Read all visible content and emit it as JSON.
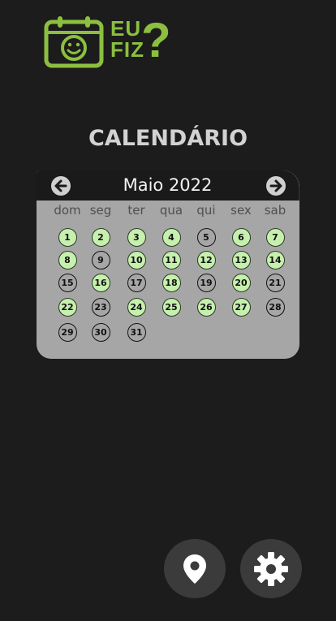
{
  "logo": {
    "line1": "EU",
    "line2": "FIZ",
    "mark": "?",
    "icon": "smiley-calendar-icon",
    "color": "#8cbf3f"
  },
  "page_title": "CALENDÁRIO",
  "calendar": {
    "month_label": "Maio 2022",
    "prev_icon": "arrow-left-icon",
    "next_icon": "arrow-right-icon",
    "weekdays": [
      "dom",
      "seg",
      "ter",
      "qua",
      "qui",
      "sex",
      "sab"
    ],
    "days": [
      {
        "label": "1",
        "status": "done"
      },
      {
        "label": "2",
        "status": "done"
      },
      {
        "label": "3",
        "status": "done"
      },
      {
        "label": "4",
        "status": "done"
      },
      {
        "label": "5",
        "status": "not-done"
      },
      {
        "label": "6",
        "status": "done"
      },
      {
        "label": "7",
        "status": "done"
      },
      {
        "label": "8",
        "status": "done"
      },
      {
        "label": "9",
        "status": "not-done"
      },
      {
        "label": "10",
        "status": "done"
      },
      {
        "label": "11",
        "status": "done"
      },
      {
        "label": "12",
        "status": "done"
      },
      {
        "label": "13",
        "status": "done"
      },
      {
        "label": "14",
        "status": "done"
      },
      {
        "label": "15",
        "status": "not-done"
      },
      {
        "label": "16",
        "status": "done"
      },
      {
        "label": "17",
        "status": "not-done"
      },
      {
        "label": "18",
        "status": "done"
      },
      {
        "label": "19",
        "status": "not-done"
      },
      {
        "label": "20",
        "status": "done"
      },
      {
        "label": "21",
        "status": "not-done"
      },
      {
        "label": "22",
        "status": "done"
      },
      {
        "label": "23",
        "status": "not-done"
      },
      {
        "label": "24",
        "status": "done"
      },
      {
        "label": "25",
        "status": "done"
      },
      {
        "label": "26",
        "status": "done"
      },
      {
        "label": "27",
        "status": "done"
      },
      {
        "label": "28",
        "status": "not-done"
      },
      {
        "label": "29",
        "status": "not-done"
      },
      {
        "label": "30",
        "status": "not-done"
      },
      {
        "label": "31",
        "status": "not-done"
      }
    ],
    "colors": {
      "done": "#c6f0ae",
      "not_done": "#a6a6a6",
      "panel": "#a6a6a6",
      "header": "#1a1a1a"
    }
  },
  "actions": [
    {
      "icon": "location-pin-icon"
    },
    {
      "icon": "gear-icon"
    }
  ]
}
